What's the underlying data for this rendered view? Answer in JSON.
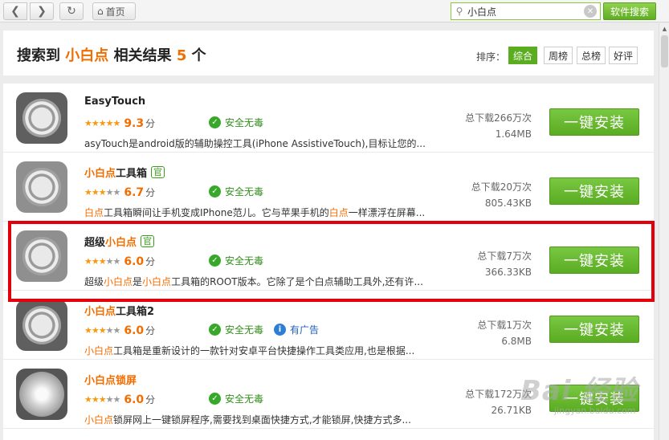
{
  "toolbar": {
    "home_label": "首页",
    "search_value": "小白点",
    "search_button": "软件搜索"
  },
  "header": {
    "title_prefix": "搜索到",
    "keyword": "小白点",
    "title_mid": "相关结果",
    "count": "5",
    "title_suffix": "个",
    "sort_label": "排序：",
    "sort_options": [
      "综合",
      "周榜",
      "总榜",
      "好评"
    ],
    "sort_active": "综合"
  },
  "apps": [
    {
      "name_parts": [
        "",
        "EasyTouch",
        ""
      ],
      "official": false,
      "stars": 5,
      "score": "9.3",
      "score_unit": "分",
      "safe": "安全无毒",
      "has_ad": false,
      "desc": "asyTouch是android版的辅助操控工具(iPhone AssistiveTouch),目标让您的...",
      "downloads": "总下载266万次",
      "size": "1.64MB",
      "install": "一键安装"
    },
    {
      "name_parts": [
        "",
        "小白点",
        "工具箱"
      ],
      "official": true,
      "official_label": "官",
      "stars": 3,
      "score": "6.7",
      "score_unit": "分",
      "safe": "安全无毒",
      "has_ad": false,
      "desc_parts": [
        "",
        "白点",
        "工具箱瞬间让手机变成IPhone范儿。它与苹果手机的",
        "白点",
        "一样漂浮在屏幕..."
      ],
      "downloads": "总下载20万次",
      "size": "805.43KB",
      "install": "一键安装"
    },
    {
      "name_parts": [
        "超级",
        "小白点",
        ""
      ],
      "official": true,
      "official_label": "官",
      "stars": 3,
      "score": "6.0",
      "score_unit": "分",
      "safe": "安全无毒",
      "has_ad": false,
      "desc_parts": [
        "超级",
        "小白点",
        "是",
        "小白点",
        "工具箱的ROOT版本。它除了是个白点辅助工具外,还有许..."
      ],
      "downloads": "总下载7万次",
      "size": "366.33KB",
      "install": "一键安装"
    },
    {
      "name_parts": [
        "",
        "小白点",
        "工具箱2"
      ],
      "official": false,
      "stars": 3,
      "score": "6.0",
      "score_unit": "分",
      "safe": "安全无毒",
      "has_ad": true,
      "ad_label": "有广告",
      "desc_parts": [
        "",
        "小白点",
        "工具箱是重新设计的一款针对安卓平台快捷操作工具类应用,也是根据..."
      ],
      "downloads": "总下载1万次",
      "size": "6.8MB",
      "install": "一键安装"
    },
    {
      "name_parts": [
        "",
        "小白点",
        "锁屏"
      ],
      "official": false,
      "stars": 3,
      "score": "6.0",
      "score_unit": "分",
      "safe": "安全无毒",
      "has_ad": false,
      "desc_parts": [
        "",
        "小白点",
        "锁屏网上一键锁屏程序,需要找到桌面快捷方式,才能锁屏,快捷方式多..."
      ],
      "downloads": "总下载172万次",
      "size": "26.71KB",
      "install": "一键安装"
    }
  ],
  "watermark": {
    "main": "Bai 经验",
    "sub": "jingyan.baidu.com"
  },
  "colors": {
    "accent_green": "#59ad1f",
    "keyword_orange": "#f26d00",
    "highlight_red": "#e3000b"
  }
}
